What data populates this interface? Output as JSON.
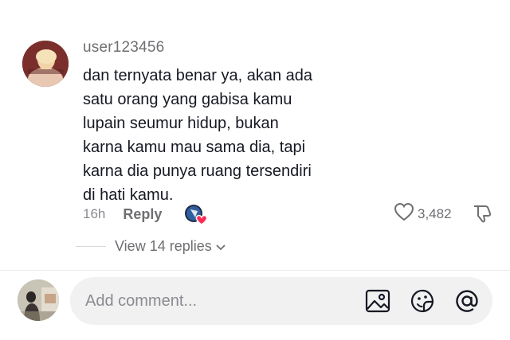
{
  "comment": {
    "username": "user123456",
    "text_lines": [
      "dan ternyata benar ya, akan ada",
      "satu orang yang gabisa kamu",
      "lupain seumur hidup, bukan",
      "karna kamu mau sama dia, tapi",
      "karna dia punya ruang tersendiri",
      "di hati kamu."
    ],
    "timestamp": "16h",
    "reply_label": "Reply",
    "like_count": "3,482",
    "view_replies_label": "View 14 replies",
    "icons": {
      "like": "heart-outline-icon",
      "dislike": "thumbs-down-icon",
      "creator_liked": "creator-liked-heart-icon",
      "expand": "chevron-down-icon"
    },
    "colors": {
      "heart_badge": "#fe2c55"
    }
  },
  "composer": {
    "placeholder": "Add comment...",
    "icons": [
      "image-icon",
      "emoji-icon",
      "mention-icon"
    ]
  }
}
